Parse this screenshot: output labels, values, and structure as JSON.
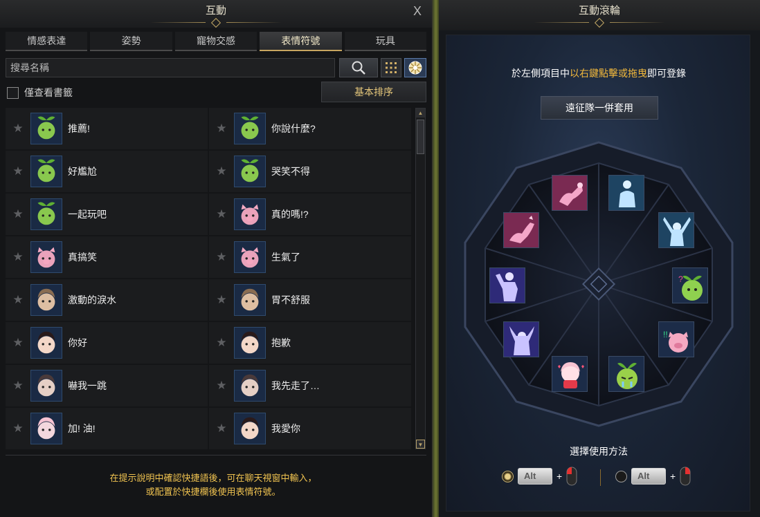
{
  "left": {
    "title": "互動",
    "close": "X",
    "tabs": [
      {
        "label": "情感表達",
        "active": false
      },
      {
        "label": "姿勢",
        "active": false
      },
      {
        "label": "寵物交感",
        "active": false
      },
      {
        "label": "表情符號",
        "active": true
      },
      {
        "label": "玩具",
        "active": false
      }
    ],
    "search_placeholder": "搜尋名稱",
    "bookmark_label": "僅查看書籤",
    "sort_label": "基本排序",
    "items": [
      {
        "label": "推薦!",
        "icon": "sprout-thumbsup-icon"
      },
      {
        "label": "你說什麼?",
        "icon": "sprout-confused-icon"
      },
      {
        "label": "好尷尬",
        "icon": "sprout-awkward-icon"
      },
      {
        "label": "哭笑不得",
        "icon": "sprout-crying-icon"
      },
      {
        "label": "一起玩吧",
        "icon": "sprout-play-icon"
      },
      {
        "label": "真的嗎!?",
        "icon": "pig-surprised-icon"
      },
      {
        "label": "真搞笑",
        "icon": "pig-laughing-icon"
      },
      {
        "label": "生氣了",
        "icon": "pig-angry-fire-icon"
      },
      {
        "label": "激動的淚水",
        "icon": "man-crying-icon"
      },
      {
        "label": "胃不舒服",
        "icon": "man-sick-icon"
      },
      {
        "label": "你好",
        "icon": "girl-hello-icon"
      },
      {
        "label": "抱歉",
        "icon": "girl-sorry-icon"
      },
      {
        "label": "嚇我一跳",
        "icon": "witch-startled-icon"
      },
      {
        "label": "我先走了…",
        "icon": "witch-leaving-icon"
      },
      {
        "label": "加! 油!",
        "icon": "girls-cheer-icon"
      },
      {
        "label": "我愛你",
        "icon": "girl-love-icon"
      }
    ],
    "hint_line1": "在提示說明中確認快捷語後，可在聊天視窗中輸入，",
    "hint_line2": "或配置於快捷欄後使用表情符號。"
  },
  "right": {
    "title": "互動滾輪",
    "instruction_pre": "於左側項目中",
    "instruction_highlight": "以右鍵點擊或拖曳",
    "instruction_post": "即可登錄",
    "party_button": "遠征隊一併套用",
    "method_label": "選擇使用方法",
    "key_label": "Alt",
    "plus": "+",
    "slots": [
      {
        "name": "slot-pet-pink-1",
        "icon": "pet-pose-icon"
      },
      {
        "name": "slot-pose-1",
        "icon": "pose-stand-icon"
      },
      {
        "name": "slot-pose-2",
        "icon": "pose-cheer-icon"
      },
      {
        "name": "slot-sprout",
        "icon": "sprout-confused-icon"
      },
      {
        "name": "slot-pig",
        "icon": "pig-surprised-icon"
      },
      {
        "name": "slot-sprout-cry",
        "icon": "sprout-crying-icon"
      },
      {
        "name": "slot-girl-love",
        "icon": "girl-love-icon"
      },
      {
        "name": "slot-pose-3",
        "icon": "pose-vsign-icon"
      },
      {
        "name": "slot-pose-4",
        "icon": "pose-flex-icon"
      },
      {
        "name": "slot-pet-pink-2",
        "icon": "pet-jump-icon"
      }
    ],
    "colors": {
      "accent": "#f3b93c",
      "hint": "#f0c350",
      "tab_active": "#c7a560"
    }
  }
}
